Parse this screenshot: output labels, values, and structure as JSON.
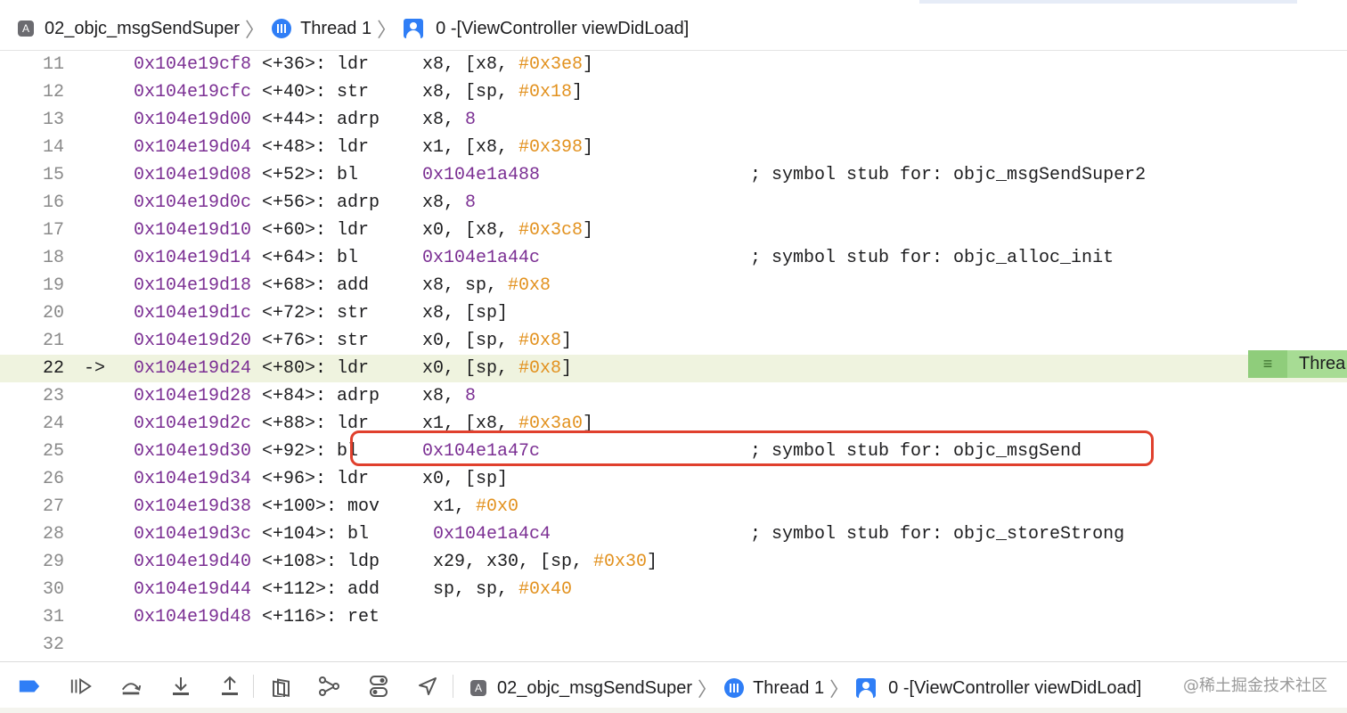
{
  "breadcrumb": {
    "project": "02_objc_msgSendSuper",
    "thread": "Thread 1",
    "frame": "0 -[ViewController viewDidLoad]"
  },
  "disassembly": [
    {
      "line": "11",
      "address": "0x104e19cf8",
      "offset": "<+36>:",
      "mnemonic": "ldr",
      "operands": [
        [
          "t",
          "x8, [x8, "
        ],
        [
          "num",
          "#0x3e8"
        ],
        [
          "t",
          "]"
        ]
      ],
      "comment": ""
    },
    {
      "line": "12",
      "address": "0x104e19cfc",
      "offset": "<+40>:",
      "mnemonic": "str",
      "operands": [
        [
          "t",
          "x8, [sp, "
        ],
        [
          "num",
          "#0x18"
        ],
        [
          "t",
          "]"
        ]
      ],
      "comment": ""
    },
    {
      "line": "13",
      "address": "0x104e19d00",
      "offset": "<+44>:",
      "mnemonic": "adrp",
      "operands": [
        [
          "t",
          "x8, "
        ],
        [
          "n8",
          "8"
        ]
      ],
      "comment": ""
    },
    {
      "line": "14",
      "address": "0x104e19d04",
      "offset": "<+48>:",
      "mnemonic": "ldr",
      "operands": [
        [
          "t",
          "x1, [x8, "
        ],
        [
          "num",
          "#0x398"
        ],
        [
          "t",
          "]"
        ]
      ],
      "comment": ""
    },
    {
      "line": "15",
      "address": "0x104e19d08",
      "offset": "<+52>:",
      "mnemonic": "bl",
      "operands": [
        [
          "addrop",
          "0x104e1a488"
        ]
      ],
      "comment": "; symbol stub for: objc_msgSendSuper2"
    },
    {
      "line": "16",
      "address": "0x104e19d0c",
      "offset": "<+56>:",
      "mnemonic": "adrp",
      "operands": [
        [
          "t",
          "x8, "
        ],
        [
          "n8",
          "8"
        ]
      ],
      "comment": ""
    },
    {
      "line": "17",
      "address": "0x104e19d10",
      "offset": "<+60>:",
      "mnemonic": "ldr",
      "operands": [
        [
          "t",
          "x0, [x8, "
        ],
        [
          "num",
          "#0x3c8"
        ],
        [
          "t",
          "]"
        ]
      ],
      "comment": ""
    },
    {
      "line": "18",
      "address": "0x104e19d14",
      "offset": "<+64>:",
      "mnemonic": "bl",
      "operands": [
        [
          "addrop",
          "0x104e1a44c"
        ]
      ],
      "comment": "; symbol stub for: objc_alloc_init"
    },
    {
      "line": "19",
      "address": "0x104e19d18",
      "offset": "<+68>:",
      "mnemonic": "add",
      "operands": [
        [
          "t",
          "x8, sp, "
        ],
        [
          "num",
          "#0x8"
        ]
      ],
      "comment": ""
    },
    {
      "line": "20",
      "address": "0x104e19d1c",
      "offset": "<+72>:",
      "mnemonic": "str",
      "operands": [
        [
          "t",
          "x8, [sp]"
        ]
      ],
      "comment": ""
    },
    {
      "line": "21",
      "address": "0x104e19d20",
      "offset": "<+76>:",
      "mnemonic": "str",
      "operands": [
        [
          "t",
          "x0, [sp, "
        ],
        [
          "num",
          "#0x8"
        ],
        [
          "t",
          "]"
        ]
      ],
      "comment": ""
    },
    {
      "line": "22",
      "address": "0x104e19d24",
      "offset": "<+80>:",
      "mnemonic": "ldr",
      "operands": [
        [
          "t",
          "x0, [sp, "
        ],
        [
          "num",
          "#0x8"
        ],
        [
          "t",
          "]"
        ]
      ],
      "comment": "",
      "current": true,
      "arrow": "->"
    },
    {
      "line": "23",
      "address": "0x104e19d28",
      "offset": "<+84>:",
      "mnemonic": "adrp",
      "operands": [
        [
          "t",
          "x8, "
        ],
        [
          "n8",
          "8"
        ]
      ],
      "comment": ""
    },
    {
      "line": "24",
      "address": "0x104e19d2c",
      "offset": "<+88>:",
      "mnemonic": "ldr",
      "operands": [
        [
          "t",
          "x1, [x8, "
        ],
        [
          "num",
          "#0x3a0"
        ],
        [
          "t",
          "]"
        ]
      ],
      "comment": ""
    },
    {
      "line": "25",
      "address": "0x104e19d30",
      "offset": "<+92>:",
      "mnemonic": "bl",
      "operands": [
        [
          "addrop",
          "0x104e1a47c"
        ]
      ],
      "comment": "; symbol stub for: objc_msgSend"
    },
    {
      "line": "26",
      "address": "0x104e19d34",
      "offset": "<+96>:",
      "mnemonic": "ldr",
      "operands": [
        [
          "t",
          "x0, [sp]"
        ]
      ],
      "comment": ""
    },
    {
      "line": "27",
      "address": "0x104e19d38",
      "offset": "<+100>:",
      "mnemonic": "mov",
      "operands": [
        [
          "t",
          "x1, "
        ],
        [
          "num",
          "#0x0"
        ]
      ],
      "comment": ""
    },
    {
      "line": "28",
      "address": "0x104e19d3c",
      "offset": "<+104>:",
      "mnemonic": "bl",
      "operands": [
        [
          "addrop",
          "0x104e1a4c4"
        ]
      ],
      "comment": "; symbol stub for: objc_storeStrong"
    },
    {
      "line": "29",
      "address": "0x104e19d40",
      "offset": "<+108>:",
      "mnemonic": "ldp",
      "operands": [
        [
          "t",
          "x29, x30, [sp, "
        ],
        [
          "num",
          "#0x30"
        ],
        [
          "t",
          "]"
        ]
      ],
      "comment": ""
    },
    {
      "line": "30",
      "address": "0x104e19d44",
      "offset": "<+112>:",
      "mnemonic": "add",
      "operands": [
        [
          "t",
          "sp, sp, "
        ],
        [
          "num",
          "#0x40"
        ]
      ],
      "comment": ""
    },
    {
      "line": "31",
      "address": "0x104e19d48",
      "offset": "<+116>:",
      "mnemonic": "ret",
      "operands": [],
      "comment": ""
    },
    {
      "line": "32",
      "address": "",
      "offset": "",
      "mnemonic": "",
      "operands": [],
      "comment": ""
    }
  ],
  "thread_badge": {
    "label": "Threa"
  },
  "debug_toolbar": {
    "icons": [
      "breakpoints-toggle-icon",
      "continue-icon",
      "step-over-icon",
      "step-into-icon",
      "step-out-icon",
      "view-hierarchy-icon",
      "memory-graph-icon",
      "environment-overrides-icon",
      "simulate-location-icon"
    ],
    "project": "02_objc_msgSendSuper",
    "thread": "Thread 1",
    "frame": "0 -[ViewController viewDidLoad]"
  },
  "watermark": "@稀土掘金技术社区",
  "colors": {
    "address": "#7b2f93",
    "immediate": "#e2911e",
    "current_line": "#eff3df",
    "highlight": "#e0402d",
    "thread_badge": "#a7dc94",
    "accent": "#2f7ef6"
  }
}
